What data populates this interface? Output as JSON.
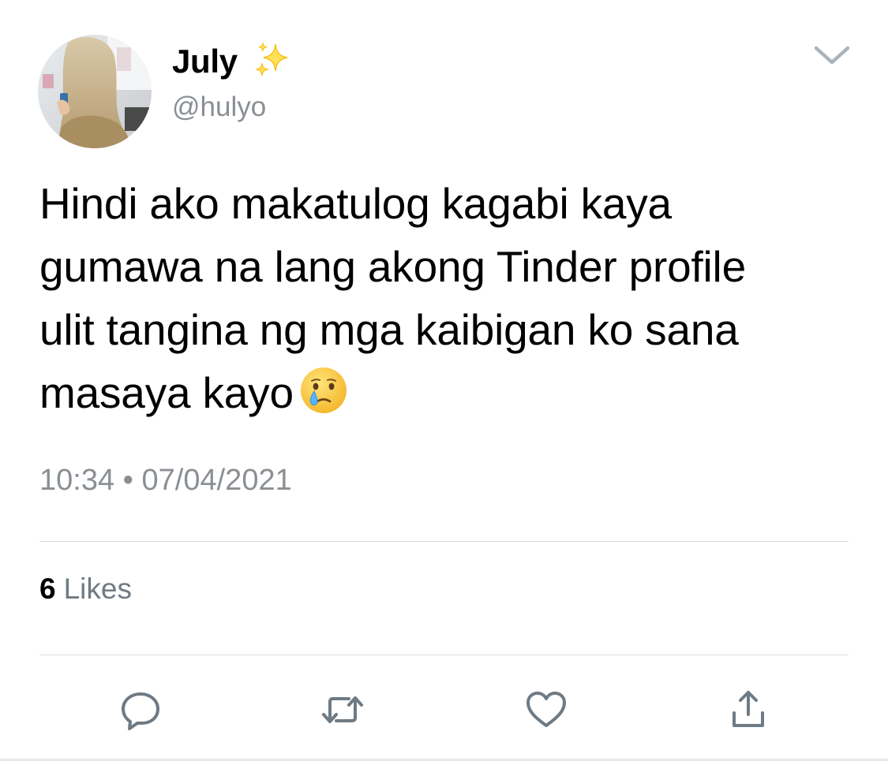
{
  "author": {
    "display_name": "July",
    "name_emoji": "sparkles-icon",
    "handle": "@hulyo",
    "avatar": "avatar-photo"
  },
  "tweet": {
    "text": "Hindi ako makatulog kagabi kaya\ngumawa na lang akong Tinder profile\nulit tangina ng mga kaibigan ko sana\nmasaya kayo",
    "emoji": "face-holding-back-tears-icon",
    "time": "10:34",
    "separator": "•",
    "date": "07/04/2021"
  },
  "engagement": {
    "likes_count": "6",
    "likes_label": "Likes"
  },
  "actions": [
    {
      "name": "reply",
      "icon": "reply-icon"
    },
    {
      "name": "retweet",
      "icon": "retweet-icon"
    },
    {
      "name": "like",
      "icon": "heart-icon"
    },
    {
      "name": "share",
      "icon": "share-icon"
    }
  ],
  "colors": {
    "secondary_text": "#8a8f94",
    "icon_gray": "#6e7a84",
    "divider": "#d8dde1"
  }
}
